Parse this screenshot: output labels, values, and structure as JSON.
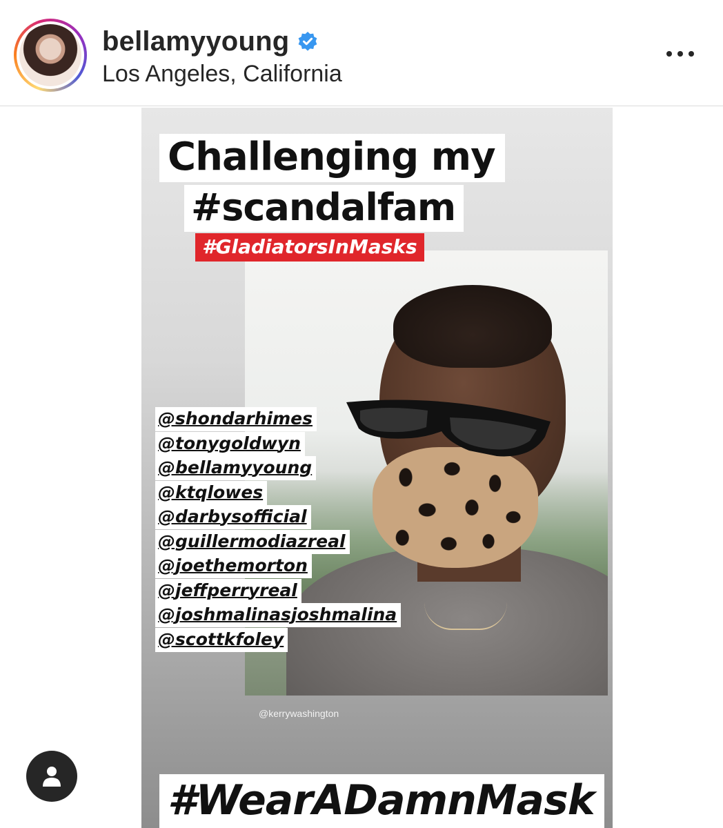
{
  "header": {
    "username": "bellamyyoung",
    "location": "Los Angeles, California",
    "verified": true
  },
  "post": {
    "title_line1": "Challenging my",
    "title_line2": "#scandalfam",
    "hashtag_red": "#GladiatorsInMasks",
    "mentions": [
      "@shondarhimes",
      "@tonygoldwyn",
      "@bellamyyoung",
      "@ktqlowes",
      "@darbysofficial",
      "@guillermodiazreal",
      "@joethemorton",
      "@jeffperryreal",
      "@joshmalinasjoshmalina",
      "@scottkfoley"
    ],
    "watermark": "@kerrywashington",
    "bottom_tag": "#WearADamnMask"
  },
  "colors": {
    "verified_blue": "#3897f0",
    "tag_red": "#e0262b",
    "text_dark": "#262626"
  },
  "icons": {
    "more": "more-options-icon",
    "tag": "user-tag-icon",
    "verified": "verified-badge-icon"
  }
}
